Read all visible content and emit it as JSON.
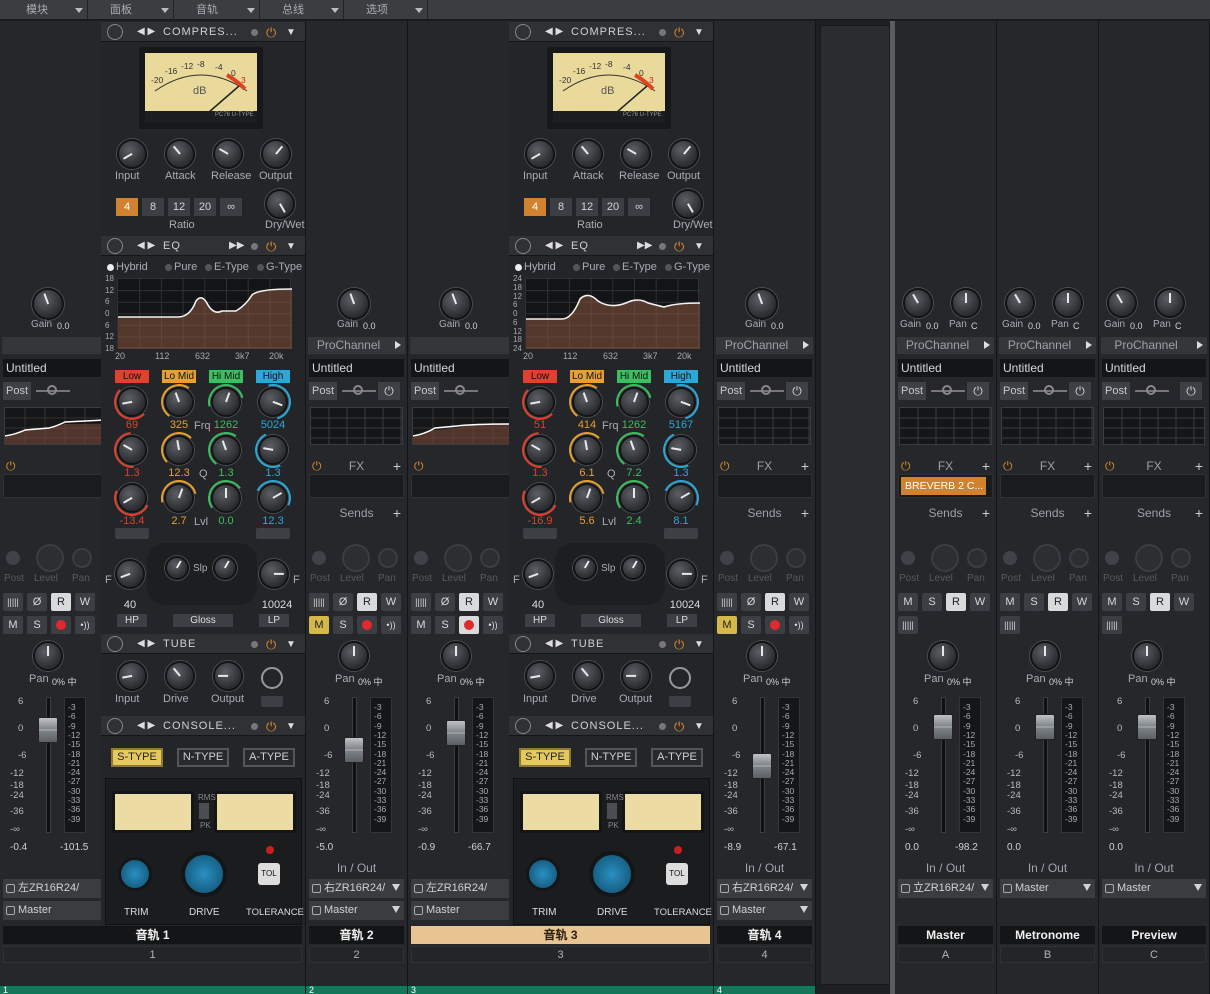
{
  "menu": [
    "模块",
    "面板",
    "音轨",
    "总线",
    "选项"
  ],
  "labels": {
    "gain": "Gain",
    "pan": "Pan",
    "prochannel": "ProChannel",
    "fx": "FX",
    "sends": "Sends",
    "post": "Post",
    "level": "Level",
    "io": "In / Out",
    "slp": "Slp",
    "gloss": "Gloss",
    "hp": "HP",
    "lp": "LP",
    "frq": "Frq",
    "q": "Q",
    "lvl": "Lvl",
    "input": "Input",
    "attack": "Attack",
    "release": "Release",
    "output": "Output",
    "ratio": "Ratio",
    "drywet": "Dry/Wet",
    "drive": "Drive",
    "trim": "TRIM",
    "drive_up": "DRIVE",
    "tolerance": "TOLERANCE",
    "tol": "TOL",
    "rms": "RMS",
    "pk": "PK",
    "db": "dB",
    "pc76": "PC76 U-TYPE",
    "f": "F",
    "hybrid": "Hybrid",
    "pure": "Pure",
    "etype": "E-Type",
    "gtype": "G-Type",
    "low": "Low",
    "lomid": "Lo Mid",
    "himid": "Hi Mid",
    "high": "High"
  },
  "module_titles": {
    "comp": "COMPRES...",
    "eq": "EQ",
    "tube": "TUBE",
    "console": "CONSOLE..."
  },
  "ratios": [
    "4",
    "8",
    "12",
    "20",
    "∞"
  ],
  "console_types": [
    "S-TYPE",
    "N-TYPE",
    "A-TYPE"
  ],
  "vu_scale": [
    "-20",
    "-16",
    "-12",
    "-8",
    "-4",
    "0",
    "3"
  ],
  "eq_axis": {
    "y": [
      "18",
      "12",
      "6",
      "0",
      "6",
      "12",
      "18"
    ],
    "y3": [
      "24",
      "18",
      "12",
      "6",
      "0",
      "6",
      "12",
      "18",
      "24"
    ],
    "x": [
      "20",
      "112",
      "632",
      "3k7",
      "20k"
    ]
  },
  "fader_scale": [
    "6",
    "0",
    "-6",
    "-12",
    "-18",
    "-24",
    "-36",
    "-∞"
  ],
  "meter_scale": [
    "-3",
    "-6",
    "-9",
    "-12",
    "-15",
    "-18",
    "-21",
    "-24",
    "-27",
    "-30",
    "-33",
    "-36",
    "-39"
  ],
  "tracks": [
    {
      "name": "音轨 1",
      "num": "1",
      "gain": "0.0",
      "pan": "0% 中",
      "title": "Untitled",
      "vol": "-0.4",
      "peak": "-101.5",
      "in": "左ZR16R24/",
      "out": "Master",
      "fx": ""
    },
    {
      "name": "音轨 2",
      "num": "2",
      "gain": "0.0",
      "pan": "0% 中",
      "title": "Untitled",
      "vol": "-5.0",
      "peak": "",
      "in": "右ZR16R24/",
      "out": "Master",
      "fx": ""
    },
    {
      "name": "音轨 3",
      "num": "3",
      "gain": "0.0",
      "pan": "0% 中",
      "title": "Untitled",
      "vol": "-0.9",
      "peak": "-66.7",
      "in": "左ZR16R24/",
      "out": "Master",
      "fx": ""
    },
    {
      "name": "音轨 4",
      "num": "4",
      "gain": "0.0",
      "pan": "0% 中",
      "title": "Untitled",
      "vol": "-8.9",
      "peak": "-67.1",
      "in": "右ZR16R24/",
      "out": "Master",
      "fx": ""
    }
  ],
  "buses": [
    {
      "name": "Master",
      "num": "A",
      "gain": "0.0",
      "pan": "0% 中",
      "panv": "C",
      "title": "Untitled",
      "vol": "0.0",
      "peak": "-98.2",
      "in": "立ZR16R24/",
      "out": "",
      "fx": "BREVERB 2 C..."
    },
    {
      "name": "Metronome",
      "num": "B",
      "gain": "0.0",
      "pan": "0% 中",
      "panv": "C",
      "title": "Untitled",
      "vol": "0.0",
      "peak": "",
      "in": "",
      "out": "Master",
      "fx": ""
    },
    {
      "name": "Preview",
      "num": "C",
      "gain": "0.0",
      "pan": "0% 中",
      "panv": "C",
      "title": "Untitled",
      "vol": "0.0",
      "peak": "",
      "in": "",
      "out": "Master",
      "fx": ""
    }
  ],
  "eq1": {
    "freq": [
      "69",
      "325",
      "1262",
      "5024"
    ],
    "q": [
      "1.3",
      "12.3",
      "1.3",
      "1.3"
    ],
    "lvl": [
      "-13.4",
      "2.7",
      "0.0",
      "12.3"
    ],
    "hp": "40",
    "lp": "10024",
    "slp": [
      "12",
      "6",
      "12",
      "6",
      "24",
      "18",
      "24",
      "18",
      "36",
      "48",
      "42",
      "48",
      "42",
      "36"
    ]
  },
  "eq3": {
    "freq": [
      "51",
      "414",
      "1262",
      "5167"
    ],
    "q": [
      "1.3",
      "6.1",
      "7.2",
      "1.3"
    ],
    "lvl": [
      "-16.9",
      "5.6",
      "2.4",
      "8.1"
    ],
    "hp": "40",
    "lp": "10024"
  },
  "buttons": {
    "m": "M",
    "s": "S",
    "r": "R",
    "w": "W"
  },
  "colors": {
    "accent": "#d0822e",
    "selected_track": "#e8c590",
    "strip_green": "#0e7a5a",
    "band_low": "#e0402e",
    "band_lomid": "#e8a030",
    "band_himid": "#3ac060",
    "band_high": "#2aa8d8"
  }
}
